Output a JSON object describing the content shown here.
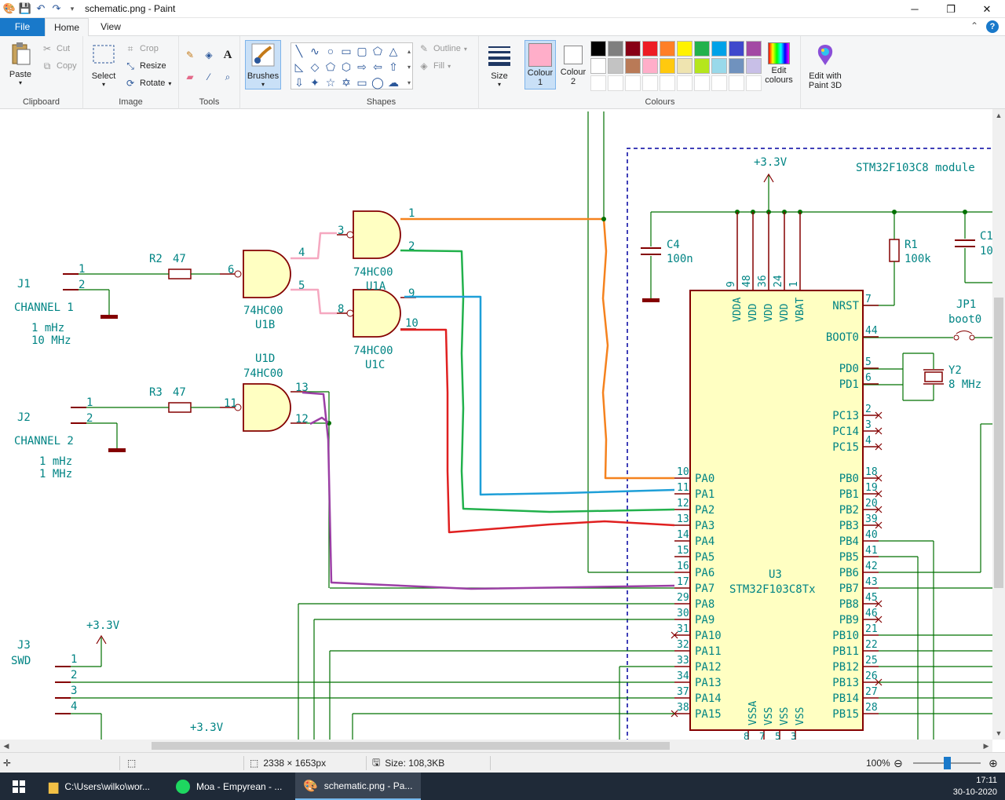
{
  "window": {
    "title": "schematic.png - Paint",
    "minimize": "─",
    "maximize": "❐",
    "close": "✕"
  },
  "tabs": {
    "file": "File",
    "home": "Home",
    "view": "View"
  },
  "ribbon": {
    "clipboard": {
      "label": "Clipboard",
      "paste": "Paste",
      "cut": "Cut",
      "copy": "Copy"
    },
    "image": {
      "label": "Image",
      "select": "Select",
      "crop": "Crop",
      "resize": "Resize",
      "rotate": "Rotate"
    },
    "tools": {
      "label": "Tools"
    },
    "brushes": "Brushes",
    "shapes": {
      "label": "Shapes",
      "outline": "Outline",
      "fill": "Fill"
    },
    "size": "Size",
    "colour1": {
      "line1": "Colour",
      "line2": "1"
    },
    "colour2": {
      "line1": "Colour",
      "line2": "2"
    },
    "colours_label": "Colours",
    "edit_colours": {
      "line1": "Edit",
      "line2": "colours"
    },
    "paint3d": {
      "line1": "Edit with",
      "line2": "Paint 3D"
    },
    "colour1_value": "#ffaec9",
    "colour2_value": "#ffffff",
    "palette_row1": [
      "#000000",
      "#7f7f7f",
      "#880015",
      "#ed1c24",
      "#ff7f27",
      "#fff200",
      "#22b14c",
      "#00a2e8",
      "#3f48cc",
      "#a349a4"
    ],
    "palette_row2": [
      "#ffffff",
      "#c3c3c3",
      "#b97a57",
      "#ffaec9",
      "#ffc90e",
      "#efe4b0",
      "#b5e61d",
      "#99d9ea",
      "#7092be",
      "#c8bfe7"
    ]
  },
  "status": {
    "dimensions": "2338 × 1653px",
    "size": "Size: 108,3KB",
    "zoom": "100%"
  },
  "taskbar": {
    "explorer": "C:\\Users\\wilko\\wor...",
    "spotify": "Moa - Empyrean - ...",
    "paint": "schematic.png - Pa...",
    "time": "17:11",
    "date": "30-10-2020"
  },
  "schematic": {
    "power_top": "+3.3V",
    "module_label": "STM32F103C8 module",
    "c4_ref": "C4",
    "c4_val": "100n",
    "r1_ref": "R1",
    "r1_val": "100k",
    "c1_ref": "C1",
    "c1_val": "10",
    "jp1_ref": "JP1",
    "jp1_val": "boot0",
    "y2_ref": "Y2",
    "y2_val": "8 MHz",
    "j1_ref": "J1",
    "j1_name": "CHANNEL 1",
    "j1_f1": "1  mHz",
    "j1_f2": "10 MHz",
    "j2_ref": "J2",
    "j2_name": "CHANNEL 2",
    "j2_f1": "1 mHz",
    "j2_f2": "1 MHz",
    "j3_ref": "J3",
    "j3_name": "SWD",
    "j3_power": "+3.3V",
    "bottom_power": "+3.3V",
    "r2_ref": "R2",
    "r2_val": "47",
    "r3_ref": "R3",
    "r3_val": "47",
    "u1a_part": "74HC00",
    "u1a_ref": "U1A",
    "u1b_part": "74HC00",
    "u1b_ref": "U1B",
    "u1c_part": "74HC00",
    "u1c_ref": "U1C",
    "u1d_ref": "U1D",
    "u1d_part": "74HC00",
    "u3_ref": "U3",
    "u3_part": "STM32F103C8Tx",
    "pin_1": "1",
    "pin_2": "2",
    "pin_3": "3",
    "pin_4": "4",
    "pin_5": "5",
    "pin_6": "6",
    "pin_8": "8",
    "pin_9": "9",
    "pin_10": "10",
    "pin_11": "11",
    "pin_12": "12",
    "pin_13": "13",
    "top_pins": [
      "9",
      "48",
      "36",
      "24",
      "1"
    ],
    "top_pin_names": [
      "VDDA",
      "VDD",
      "VDD",
      "VDD",
      "VBAT"
    ],
    "bottom_pin_names": [
      "VSSA",
      "VSS",
      "VSS",
      "VSS"
    ],
    "bottom_pins": [
      "8",
      "7",
      "5",
      "3"
    ],
    "left_pins": [
      {
        "num": "10",
        "name": "PA0"
      },
      {
        "num": "11",
        "name": "PA1"
      },
      {
        "num": "12",
        "name": "PA2"
      },
      {
        "num": "13",
        "name": "PA3"
      },
      {
        "num": "14",
        "name": "PA4"
      },
      {
        "num": "15",
        "name": "PA5"
      },
      {
        "num": "16",
        "name": "PA6"
      },
      {
        "num": "17",
        "name": "PA7"
      },
      {
        "num": "29",
        "name": "PA8"
      },
      {
        "num": "30",
        "name": "PA9"
      },
      {
        "num": "31",
        "name": "PA10"
      },
      {
        "num": "32",
        "name": "PA11"
      },
      {
        "num": "33",
        "name": "PA12"
      },
      {
        "num": "34",
        "name": "PA13"
      },
      {
        "num": "37",
        "name": "PA14"
      },
      {
        "num": "38",
        "name": "PA15"
      }
    ],
    "right_pins_top": [
      {
        "num": "7",
        "name": "NRST"
      },
      {
        "num": "44",
        "name": "BOOT0"
      },
      {
        "num": "5",
        "name": "PD0"
      },
      {
        "num": "6",
        "name": "PD1"
      },
      {
        "num": "2",
        "name": "PC13"
      },
      {
        "num": "3",
        "name": "PC14"
      },
      {
        "num": "4",
        "name": "PC15"
      }
    ],
    "right_pins": [
      {
        "num": "18",
        "name": "PB0"
      },
      {
        "num": "19",
        "name": "PB1"
      },
      {
        "num": "20",
        "name": "PB2"
      },
      {
        "num": "39",
        "name": "PB3"
      },
      {
        "num": "40",
        "name": "PB4"
      },
      {
        "num": "41",
        "name": "PB5"
      },
      {
        "num": "42",
        "name": "PB6"
      },
      {
        "num": "43",
        "name": "PB7"
      },
      {
        "num": "45",
        "name": "PB8"
      },
      {
        "num": "46",
        "name": "PB9"
      },
      {
        "num": "21",
        "name": "PB10"
      },
      {
        "num": "22",
        "name": "PB11"
      },
      {
        "num": "25",
        "name": "PB12"
      },
      {
        "num": "26",
        "name": "PB13"
      },
      {
        "num": "27",
        "name": "PB14"
      },
      {
        "num": "28",
        "name": "PB15"
      }
    ],
    "j3_pins": [
      "1",
      "2",
      "3",
      "4"
    ],
    "j_pins": [
      "1",
      "2"
    ]
  },
  "colors": {
    "wire": "#007000",
    "text": "#008484",
    "pin": "#840000",
    "body": "#ffffc2",
    "orange": "#f5821e",
    "green": "#22b14c",
    "blue": "#1e9fd8",
    "red": "#e02020",
    "pink": "#f5a8c0",
    "purple": "#9b3fa5",
    "border": "#0000a0"
  }
}
